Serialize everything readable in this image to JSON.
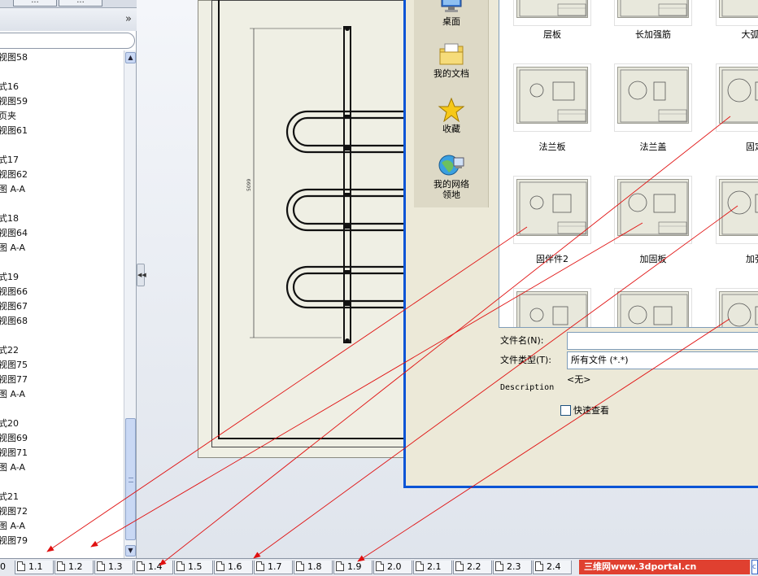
{
  "panel": {
    "tabs": [
      "...",
      "..."
    ],
    "expand_chevron": "»",
    "tree_items": [
      {
        "label": "视图58"
      },
      {
        "label": "式16"
      },
      {
        "label": "视图59"
      },
      {
        "label": "页夹"
      },
      {
        "label": "视图61"
      },
      {
        "label": "式17"
      },
      {
        "label": "视图62"
      },
      {
        "label": "图 A-A"
      },
      {
        "label": "式18"
      },
      {
        "label": "视图64"
      },
      {
        "label": "图 A-A"
      },
      {
        "label": "式19"
      },
      {
        "label": "视图66"
      },
      {
        "label": "视图67"
      },
      {
        "label": "视图68"
      },
      {
        "label": "式22"
      },
      {
        "label": "视图75"
      },
      {
        "label": "视图77"
      },
      {
        "label": "图 A-A"
      },
      {
        "label": "式20"
      },
      {
        "label": "视图69"
      },
      {
        "label": "视图71"
      },
      {
        "label": "图 A-A"
      },
      {
        "label": "式21"
      },
      {
        "label": "视图72"
      },
      {
        "label": "图 A-A"
      },
      {
        "label": "视图79"
      }
    ]
  },
  "drawing": {
    "dimension_text": "5099"
  },
  "dialog": {
    "places": [
      {
        "label": "桌面",
        "icon": "desktop-icon"
      },
      {
        "label": "我的文档",
        "icon": "my-documents-icon"
      },
      {
        "label": "收藏",
        "icon": "favorites-star-icon"
      },
      {
        "label": "我的网络\n领地",
        "icon": "network-places-icon"
      }
    ],
    "files": [
      {
        "label": "层板"
      },
      {
        "label": "长加强筋"
      },
      {
        "label": "大弧桌"
      },
      {
        "label": "法兰板"
      },
      {
        "label": "法兰盖"
      },
      {
        "label": "固定"
      },
      {
        "label": "固伴件2"
      },
      {
        "label": "加固板"
      },
      {
        "label": "加强"
      },
      {
        "label": ""
      },
      {
        "label": ""
      },
      {
        "label": ""
      }
    ],
    "filename_label": "文件名(N):",
    "filename_value": "",
    "filetype_label": "文件类型(T):",
    "filetype_value": "所有文件 (*.*)",
    "description_label": "Description",
    "description_value": "<无>",
    "quickview_label": "快速查看",
    "quickview_checked": false
  },
  "sheet_tabs": {
    "first": "0",
    "tabs": [
      "1.1",
      "1.2",
      "1.3",
      "1.4",
      "1.5",
      "1.6",
      "1.7",
      "1.8",
      "1.9",
      "2.0",
      "2.1",
      "2.2",
      "2.3",
      "2.4"
    ]
  },
  "watermark": "三维网www.3dportal.cn",
  "colors": {
    "annotation_arrow": "#e01010",
    "dialog_border": "#0a54d6",
    "sheet_paper": "#efefe4"
  }
}
